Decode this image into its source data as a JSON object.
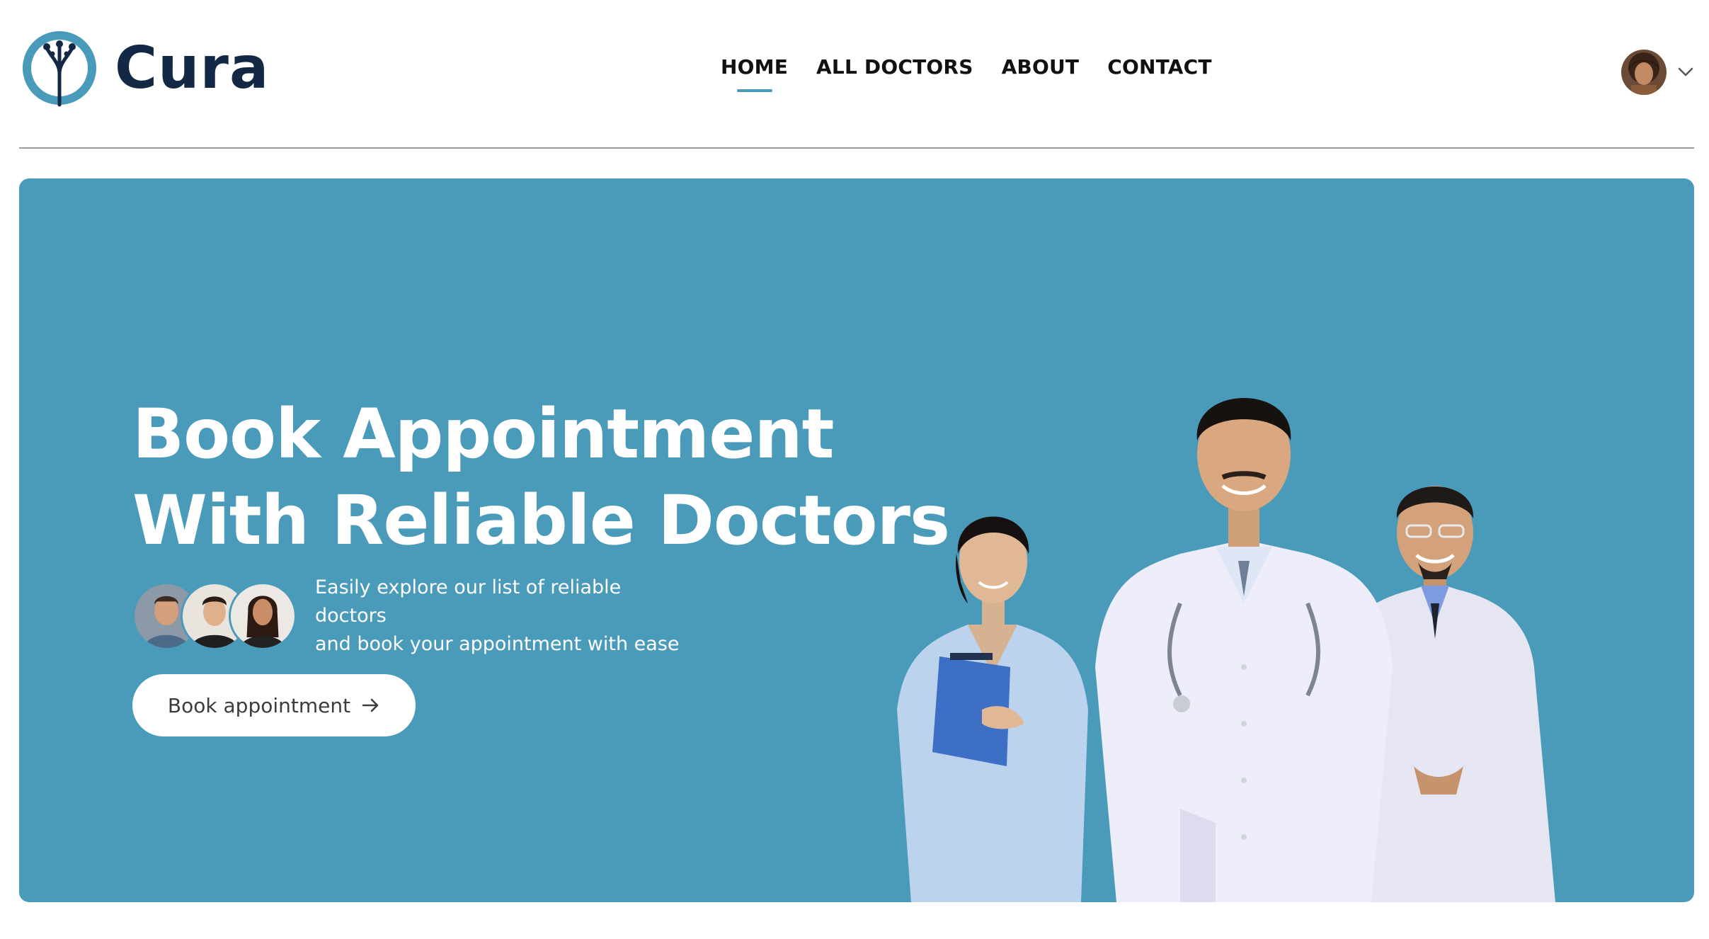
{
  "brand": {
    "name": "Cura",
    "logo_icon": "tree-logo-icon"
  },
  "nav": {
    "items": [
      {
        "label": "HOME",
        "active": true
      },
      {
        "label": "ALL DOCTORS",
        "active": false
      },
      {
        "label": "ABOUT",
        "active": false
      },
      {
        "label": "CONTACT",
        "active": false
      }
    ]
  },
  "profile": {
    "avatar_icon": "user-avatar",
    "dropdown_icon": "chevron-down-icon"
  },
  "hero": {
    "title_line1": "Book Appointment",
    "title_line2": "With Reliable Doctors",
    "description_line1": "Easily explore our list of reliable doctors",
    "description_line2": "and book your appointment with ease",
    "cta_label": "Book appointment",
    "cta_icon": "arrow-right-icon",
    "background_color": "#4a9aba",
    "image": "doctors-group-photo"
  },
  "colors": {
    "accent": "#4a9aba",
    "brand_text": "#122845",
    "divider": "#9a9a9a"
  }
}
